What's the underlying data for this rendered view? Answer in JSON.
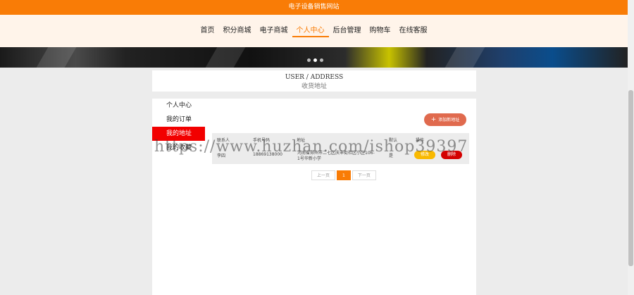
{
  "header": {
    "site_title": "电子设备销售网站"
  },
  "nav": {
    "items": [
      "首页",
      "积分商城",
      "电子商城",
      "个人中心",
      "后台管理",
      "购物车",
      "在线客服"
    ],
    "active_index": 3
  },
  "page": {
    "title_en": "USER / ADDRESS",
    "title_cn": "收货地址"
  },
  "sidebar": {
    "items": [
      "个人中心",
      "我的订单",
      "我的地址",
      "我的收藏"
    ],
    "active_index": 2
  },
  "add_address_label": "添加新地址",
  "table": {
    "headers": [
      "联系人",
      "手机号码",
      "地址",
      "默认",
      "操作"
    ],
    "rows": [
      {
        "contact": "李四",
        "phone": "18869138000",
        "address": "河南省郑州市二七区庆丰街社区小区106-1号华新小学",
        "default": "是",
        "edit": "修改",
        "delete": "删除"
      }
    ]
  },
  "pagination": {
    "prev": "上一页",
    "current": "1",
    "next": "下一页"
  },
  "watermark": "https://www.huzhan.com/ishop39397",
  "colors": {
    "brand": "#f97c06",
    "active_side": "#f20000",
    "add_button": "#e06a4e",
    "edit": "#f9b900",
    "delete": "#d40000"
  }
}
